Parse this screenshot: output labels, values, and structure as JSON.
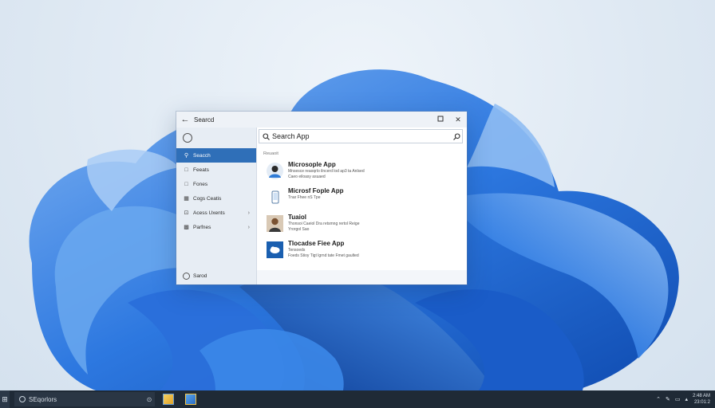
{
  "window": {
    "title": "Searcd",
    "back_icon": "arrow-left-icon",
    "controls": [
      "restore-icon",
      "close-icon"
    ]
  },
  "sidebar": {
    "profile_icon": "profile-icon",
    "items": [
      {
        "label": "Seacch",
        "icon": "search-icon",
        "active": true,
        "chevron": false
      },
      {
        "label": "Feeats",
        "icon": "page-icon",
        "active": false,
        "chevron": false
      },
      {
        "label": "Fones",
        "icon": "page-icon",
        "active": false,
        "chevron": false
      },
      {
        "label": "Cogs Ceatis",
        "icon": "folder-icon",
        "active": false,
        "chevron": false
      },
      {
        "label": "Acess Uxents",
        "icon": "apps-icon",
        "active": false,
        "chevron": true
      },
      {
        "label": "Parfnes",
        "icon": "grid-icon",
        "active": false,
        "chevron": true
      }
    ],
    "bottom_item": {
      "label": "Sarod",
      "icon": "settings-icon"
    }
  },
  "search": {
    "value": "Search App",
    "section_label": "Reuaoit"
  },
  "results": [
    {
      "name": "Microsople App",
      "desc": [
        "Mnsesce reaoqrlo ilncerd lod ap3 ta Anlsed",
        "Caeo eiloasy asuaed"
      ],
      "thumb": "person-avatar-icon"
    },
    {
      "name": "Microsf Fople App",
      "desc": [
        "Tnar Fhee nS Tpe"
      ],
      "thumb": "phone-app-icon"
    },
    {
      "name": "Tuaiol",
      "desc": [
        "Thonsoi Caeiol Dra retsmng rertol Reige",
        "Yrorgol Sao"
      ],
      "thumb": "person-photo-icon"
    },
    {
      "name": "Tlocadse Fiee App",
      "desc": [
        "Tensoeds",
        "Foeds Stioy Tigt lgrnd tate Fmet gaulted"
      ],
      "thumb": "cloud-app-icon"
    }
  ],
  "taskbar": {
    "start_icon": "start-icon",
    "search_label": "SEqorlors",
    "search_icon": "search-ring-icon",
    "mic_icon": "mic-icon",
    "pinned": [
      {
        "name": "explorer-app-icon",
        "color": "#e8b437"
      },
      {
        "name": "store-app-icon",
        "color": "#3b8ed8"
      }
    ],
    "tray_icons": [
      "chevron-up-icon",
      "pen-icon",
      "battery-icon",
      "network-icon"
    ],
    "clock": [
      "2:48 AM",
      "23:01:2"
    ]
  },
  "colors": {
    "accent": "#2f6fb8",
    "taskbar": "#1f2a36",
    "wallpaper_blue": "#1e64d4"
  }
}
